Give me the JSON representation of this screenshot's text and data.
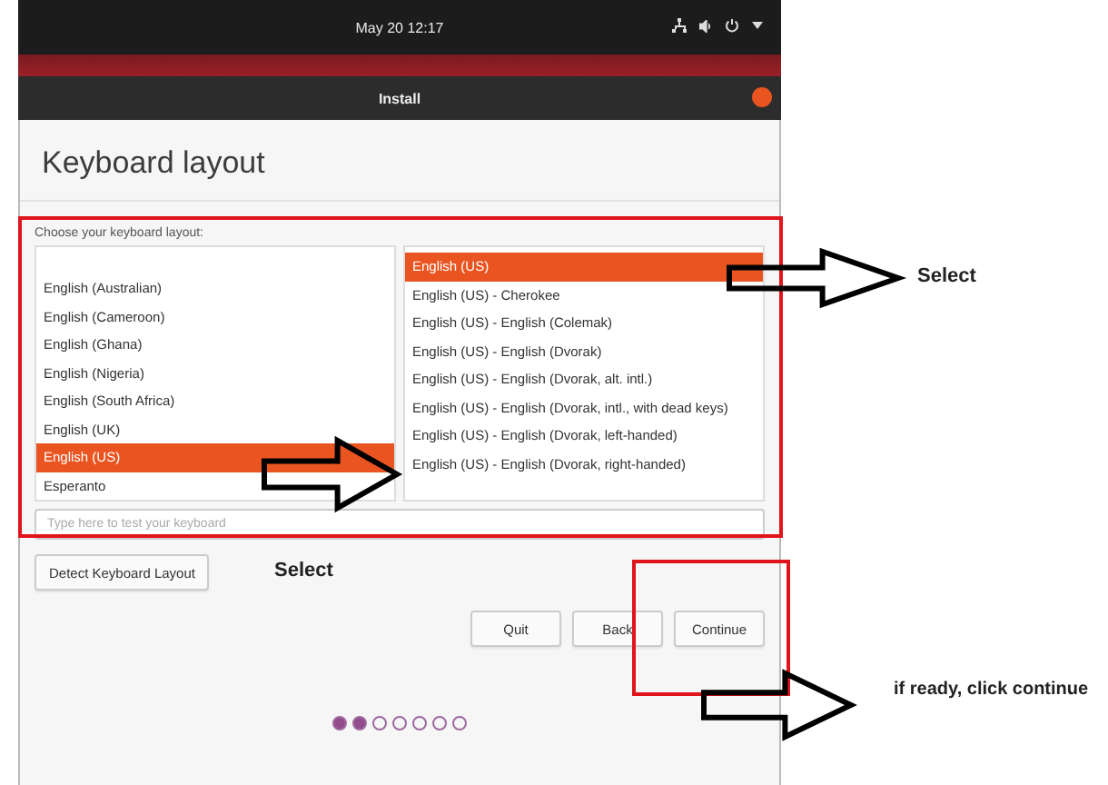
{
  "top_bar": {
    "clock": "May 20  12:17"
  },
  "window": {
    "title": "Install"
  },
  "page": {
    "heading": "Keyboard layout",
    "prompt": "Choose your keyboard layout:"
  },
  "layouts": [
    {
      "label": "English (Australian)",
      "selected": false
    },
    {
      "label": "English (Cameroon)",
      "selected": false
    },
    {
      "label": "English (Ghana)",
      "selected": false
    },
    {
      "label": "English (Nigeria)",
      "selected": false
    },
    {
      "label": "English (South Africa)",
      "selected": false
    },
    {
      "label": "English (UK)",
      "selected": false
    },
    {
      "label": "English (US)",
      "selected": true
    },
    {
      "label": "Esperanto",
      "selected": false
    }
  ],
  "variants": [
    {
      "label": "English (US)",
      "selected": true
    },
    {
      "label": "English (US) - Cherokee",
      "selected": false
    },
    {
      "label": "English (US) - English (Colemak)",
      "selected": false
    },
    {
      "label": "English (US) - English (Dvorak)",
      "selected": false
    },
    {
      "label": "English (US) - English (Dvorak, alt. intl.)",
      "selected": false
    },
    {
      "label": "English (US) - English (Dvorak, intl., with dead keys)",
      "selected": false
    },
    {
      "label": "English (US) - English (Dvorak, left-handed)",
      "selected": false
    },
    {
      "label": "English (US) - English (Dvorak, right-handed)",
      "selected": false
    }
  ],
  "test_field": {
    "placeholder": "Type here to test your keyboard"
  },
  "detect_button": "Detect Keyboard Layout",
  "buttons": [
    "Quit",
    "Back",
    "Continue"
  ],
  "progress_dots": [
    {
      "filled": true
    },
    {
      "filled": true
    },
    {
      "filled": false
    },
    {
      "filled": false
    },
    {
      "filled": false
    },
    {
      "filled": false
    },
    {
      "filled": false
    }
  ],
  "annotations": [
    "Select",
    "Select",
    "if ready, click continue"
  ]
}
